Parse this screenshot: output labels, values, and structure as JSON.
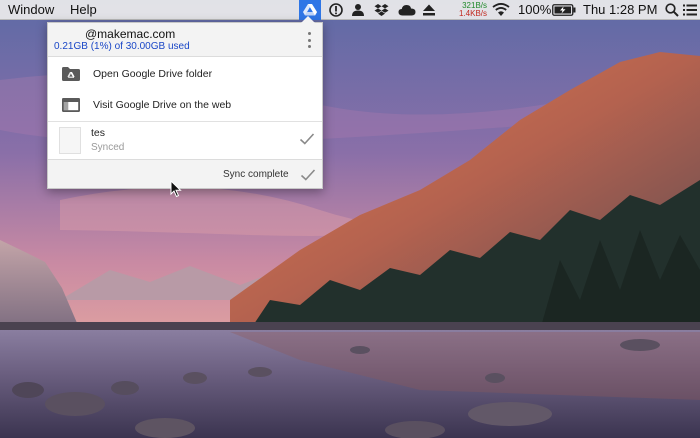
{
  "menubar": {
    "menus": [
      "Window",
      "Help"
    ],
    "network": {
      "upload": "321B/s",
      "download": "1.4KB/s"
    },
    "battery_percent": "100%",
    "clock": "Thu 1:28 PM",
    "status_icons": [
      "google-drive-icon",
      "info-icon",
      "user-icon",
      "dropbox-icon",
      "cloud-icon",
      "eject-icon",
      "wifi-icon",
      "battery-icon",
      "spotlight-search-icon",
      "notification-list-icon"
    ]
  },
  "drive_popover": {
    "account_email": "@makemac.com",
    "storage_usage": "0.21GB (1%) of 30.00GB used",
    "actions": [
      {
        "label": "Open Google Drive folder",
        "icon": "drive-folder-icon"
      },
      {
        "label": "Visit Google Drive on the web",
        "icon": "web-window-icon"
      }
    ],
    "recent_file": {
      "name": "tes",
      "status": "Synced"
    },
    "footer_status": "Sync complete"
  },
  "colors": {
    "drive_icon_highlight": "#2f76e6",
    "usage_text": "#1a47c7",
    "upload_speed": "#1f8a2a",
    "download_speed": "#c2281f"
  }
}
